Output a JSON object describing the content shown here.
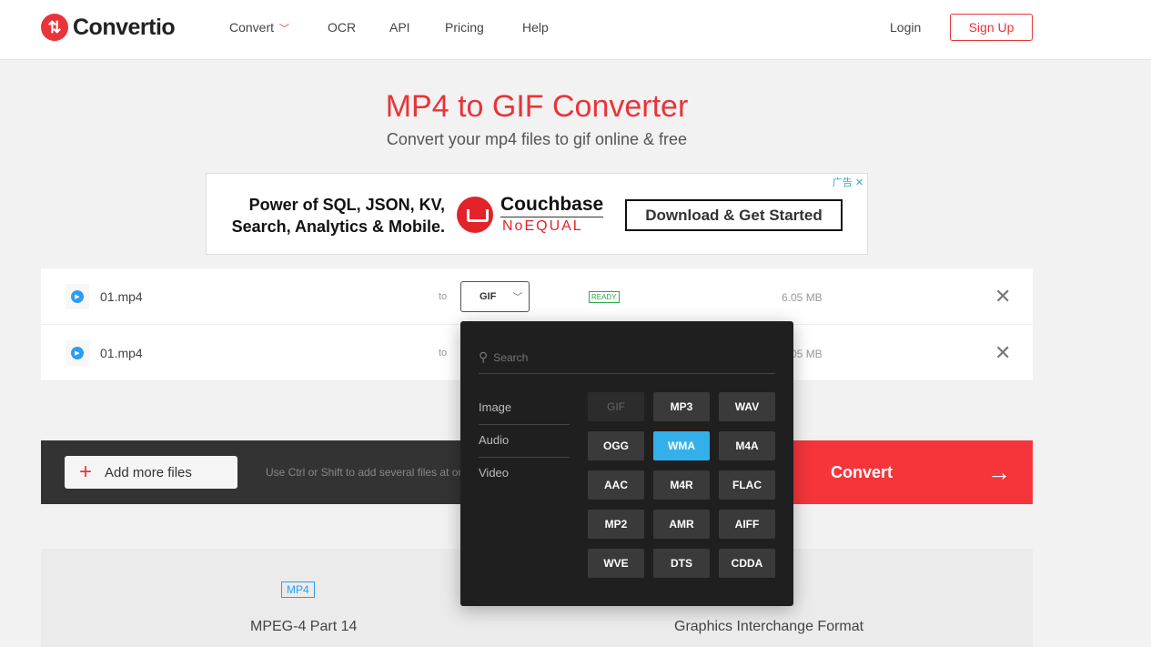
{
  "header": {
    "brand": "Convertio",
    "nav": [
      "Convert",
      "OCR",
      "API",
      "Pricing",
      "Help"
    ],
    "login": "Login",
    "signup": "Sign Up"
  },
  "hero": {
    "title": "MP4 to GIF Converter",
    "subtitle": "Convert your mp4 files to gif online & free"
  },
  "ad": {
    "text_line1": "Power of SQL, JSON, KV,",
    "text_line2": "Search, Analytics & Mobile.",
    "brand": "Couchbase",
    "tagline": "NoEQUAL",
    "cta": "Download & Get Started",
    "tag": "广告"
  },
  "files": [
    {
      "name": "01.mp4",
      "to": "to",
      "format": "GIF",
      "status": "READY",
      "size": "6.05 MB"
    },
    {
      "name": "01.mp4",
      "to": "to",
      "size": "6.05 MB"
    }
  ],
  "actions": {
    "add_more": "Add more files",
    "hint": "Use Ctrl or Shift to add several files at once",
    "convert": "Convert"
  },
  "info": {
    "source_badge": "MP4",
    "source_name": "MPEG-4 Part 14",
    "target_name": "Graphics Interchange Format"
  },
  "dropdown": {
    "search_placeholder": "Search",
    "categories": [
      "Image",
      "Audio",
      "Video"
    ],
    "options": [
      "GIF",
      "MP3",
      "WAV",
      "OGG",
      "WMA",
      "M4A",
      "AAC",
      "M4R",
      "FLAC",
      "MP2",
      "AMR",
      "AIFF",
      "WVE",
      "DTS",
      "CDDA"
    ],
    "disabled": "GIF",
    "selected": "WMA"
  },
  "colors": {
    "brand": "#e8343a",
    "accent": "#33b0ea",
    "ready": "#2ba94d"
  }
}
